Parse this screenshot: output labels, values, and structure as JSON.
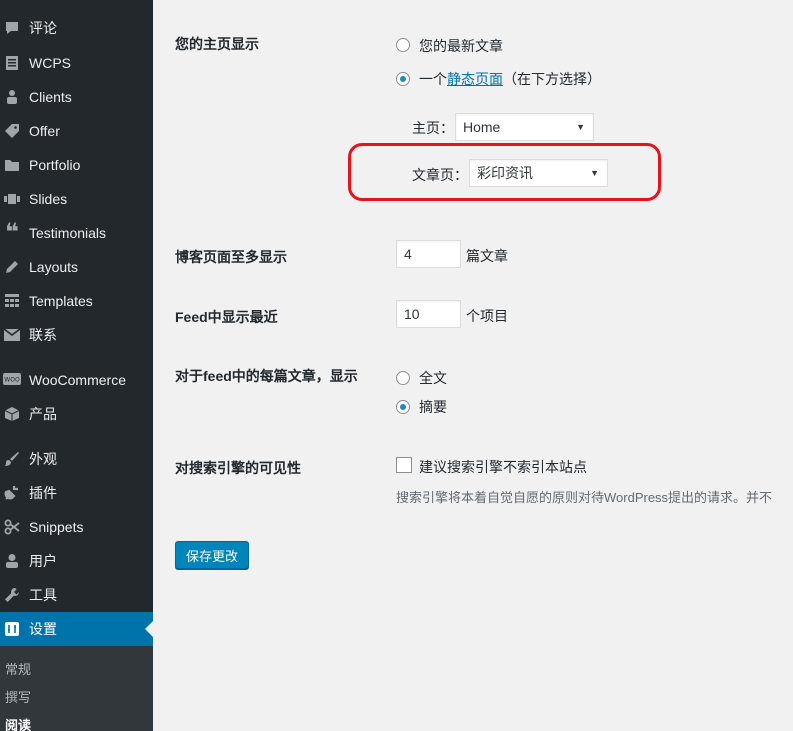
{
  "sidebar": {
    "items": [
      {
        "label": "评论",
        "icon": "comment-icon"
      },
      {
        "label": "WCPS",
        "icon": "document-icon"
      },
      {
        "label": "Clients",
        "icon": "users-icon"
      },
      {
        "label": "Offer",
        "icon": "tag-icon"
      },
      {
        "label": "Portfolio",
        "icon": "folder-icon"
      },
      {
        "label": "Slides",
        "icon": "slides-icon"
      },
      {
        "label": "Testimonials",
        "icon": "quote-icon"
      },
      {
        "label": "Layouts",
        "icon": "pencil-icon"
      },
      {
        "label": "Templates",
        "icon": "table-icon"
      },
      {
        "label": "联系",
        "icon": "mail-icon"
      },
      {
        "label": "WooCommerce",
        "icon": "woo-icon"
      },
      {
        "label": "产品",
        "icon": "box-icon"
      },
      {
        "label": "外观",
        "icon": "brush-icon"
      },
      {
        "label": "插件",
        "icon": "plug-icon"
      },
      {
        "label": "Snippets",
        "icon": "scissors-icon"
      },
      {
        "label": "用户",
        "icon": "user-icon"
      },
      {
        "label": "工具",
        "icon": "wrench-icon"
      },
      {
        "label": "设置",
        "icon": "settings-icon"
      }
    ],
    "submenu": [
      "常规",
      "撰写",
      "阅读"
    ]
  },
  "settings": {
    "homepage": {
      "label": "您的主页显示",
      "option_latest": "您的最新文章",
      "option_static_prefix": "一个",
      "option_static_link": "静态页面",
      "option_static_suffix": "（在下方选择）",
      "front_label": "主页：",
      "front_value": "Home",
      "posts_label": "文章页：",
      "posts_value": "彩印资讯"
    },
    "blog_pages": {
      "label": "博客页面至多显示",
      "value": "4",
      "suffix": "篇文章"
    },
    "feed_recent": {
      "label": "Feed中显示最近",
      "value": "10",
      "suffix": "个项目"
    },
    "feed_content": {
      "label": "对于feed中的每篇文章，显示",
      "option_full": "全文",
      "option_summary": "摘要"
    },
    "visibility": {
      "label": "对搜索引擎的可见性",
      "checkbox_label": "建议搜索引擎不索引本站点",
      "description": "搜索引擎将本着自觉自愿的原则对待WordPress提出的请求。并不"
    },
    "save_label": "保存更改"
  },
  "colors": {
    "accent": "#0073aa",
    "highlight": "#e8131a"
  }
}
